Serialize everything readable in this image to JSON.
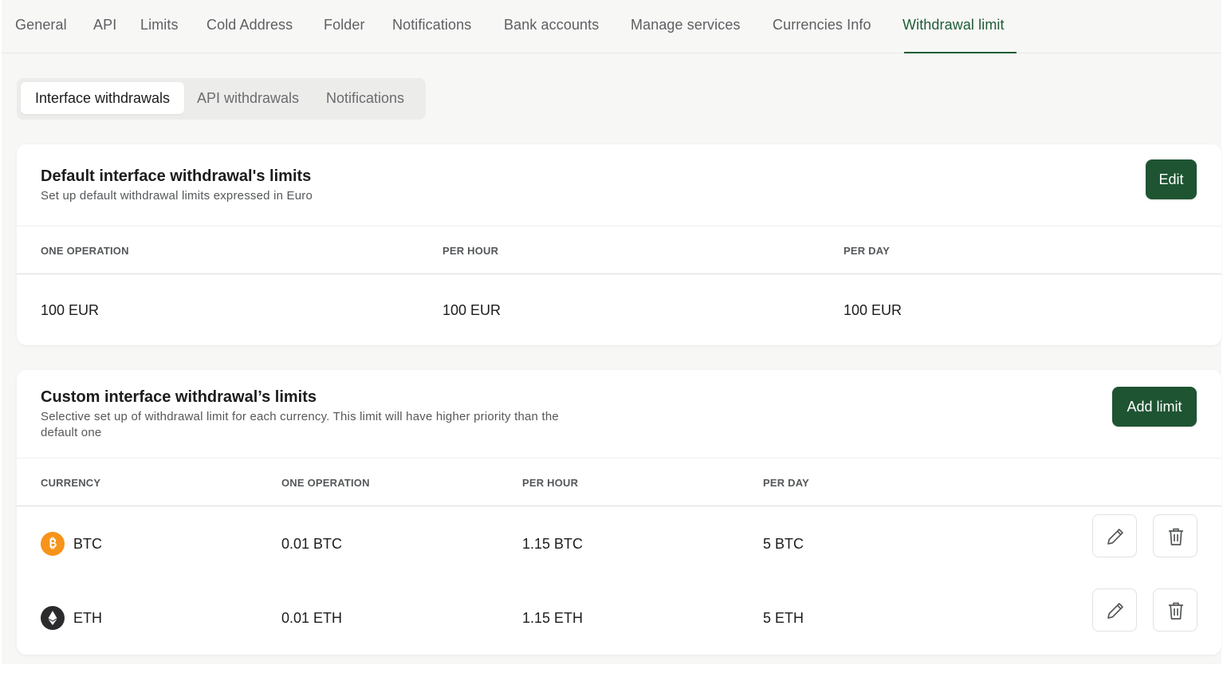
{
  "top_tabs": [
    {
      "label": "General"
    },
    {
      "label": "API"
    },
    {
      "label": "Limits"
    },
    {
      "label": "Cold Address"
    },
    {
      "label": "Folder"
    },
    {
      "label": "Notifications"
    },
    {
      "label": "Bank accounts"
    },
    {
      "label": "Manage services"
    },
    {
      "label": "Currencies Info"
    },
    {
      "label": "Withdrawal limit",
      "active": true
    }
  ],
  "sub_tabs": [
    {
      "label": "Interface withdrawals",
      "active": true
    },
    {
      "label": "API withdrawals"
    },
    {
      "label": "Notifications"
    }
  ],
  "default_limits": {
    "title": "Default interface withdrawal's limits",
    "subtitle": "Set up default withdrawal limits expressed in Euro",
    "edit_label": "Edit",
    "columns": [
      "ONE OPERATION",
      "PER HOUR",
      "PER DAY"
    ],
    "values": [
      "100 EUR",
      "100 EUR",
      "100 EUR"
    ]
  },
  "custom_limits": {
    "title": "Custom interface withdrawal’s limits",
    "subtitle_line1": "Selective set up of withdrawal limit for each currency. This limit will have higher priority than the",
    "subtitle_line2": "default one",
    "add_label": "Add limit",
    "columns": [
      "CURRENCY",
      "ONE OPERATION",
      "PER HOUR",
      "PER DAY"
    ],
    "rows": [
      {
        "currency": "BTC",
        "icon": "bitcoin-icon",
        "one_operation": "0.01 BTC",
        "per_hour": "1.15 BTC",
        "per_day": "5 BTC"
      },
      {
        "currency": "ETH",
        "icon": "ethereum-icon",
        "one_operation": "0.01 ETH",
        "per_hour": "1.15 ETH",
        "per_day": "5 ETH"
      }
    ]
  },
  "colors": {
    "accent": "#1e5432",
    "active_tab_text": "#1f5c36",
    "btc": "#f7931a",
    "eth": "#2b2b2e",
    "page_bg": "#f7f7f6"
  }
}
